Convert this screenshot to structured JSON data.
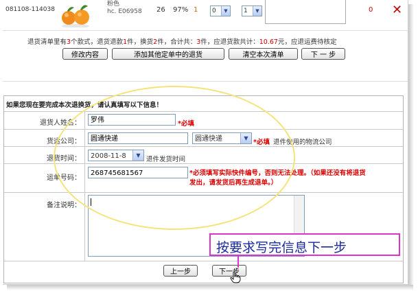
{
  "product_row": {
    "code": "081108-114038",
    "name_line1": "粉色",
    "name_line2": "hc. E06958",
    "quantity": "26",
    "percent": "97%",
    "ordinal": "1",
    "select_a": "0",
    "select_b": "1",
    "amount": "0",
    "delete_icon": "x-icon"
  },
  "summary": {
    "p1": "退货清单里有",
    "styles": "3",
    "p2": "个款式，退货退款",
    "refund_count": "1",
    "p3": "件，换货",
    "exchange_count": "2",
    "p4": "件，合计共：",
    "total": "3",
    "p5": "件，应退货款共计：",
    "amount": "10.67",
    "p6": "元，应退运费待核定"
  },
  "actions": {
    "modify": "修改内容",
    "add_other": "添加其他定单中的退货",
    "clear": "清空本次清单",
    "next": "下 一 步"
  },
  "form": {
    "header": "如果您现在要完成本次退换货，请认真填写以下信息！",
    "name_label": "退货人姓名：",
    "name_value": "罗伟",
    "required": "*必填",
    "carrier_label": "货运公司：",
    "carrier_value": "圆通快递",
    "carrier_select": "圆通快递",
    "carrier_hint": "退件使用的物流公司",
    "date_label": "退货时间：",
    "date_value": "2008-11-8",
    "date_hint": "退件发货时间",
    "tracking_label": "运单号码：",
    "tracking_value": "268745681567",
    "tracking_warn_line1": "*必须填写实际快件编号，否则无法处理。（如果还没有将退货",
    "tracking_warn_line2": "发出，请发货后再生成退单。）",
    "remarks_label": "备注说明：",
    "prev_button": "上一步",
    "next_button": "下一步"
  },
  "annotation": {
    "callout": "按要求写完信息下一步"
  },
  "colors": {
    "required_red": "#dd0000",
    "callout_border": "#dd33cc",
    "callout_text": "#1a2a9c",
    "highlight_ellipse": "#f5e37a"
  }
}
